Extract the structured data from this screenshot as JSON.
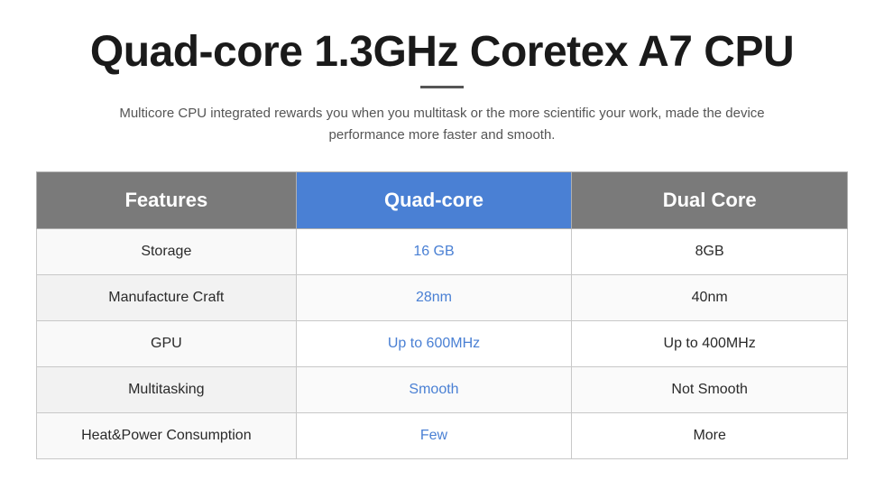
{
  "header": {
    "title": "Quad-core 1.3GHz Coretex A7 CPU",
    "subtitle": "Multicore CPU integrated rewards you when you multitask or the more scientific your work, made the device performance more faster and smooth."
  },
  "table": {
    "columns": {
      "features": "Features",
      "quad": "Quad-core",
      "dual": "Dual Core"
    },
    "rows": [
      {
        "feature": "Storage",
        "quad_value": "16 GB",
        "dual_value": "8GB"
      },
      {
        "feature": "Manufacture Craft",
        "quad_value": "28nm",
        "dual_value": "40nm"
      },
      {
        "feature": "GPU",
        "quad_value": "Up to 600MHz",
        "dual_value": "Up to 400MHz"
      },
      {
        "feature": "Multitasking",
        "quad_value": "Smooth",
        "dual_value": "Not Smooth"
      },
      {
        "feature": "Heat&Power Consumption",
        "quad_value": "Few",
        "dual_value": "More"
      }
    ]
  }
}
